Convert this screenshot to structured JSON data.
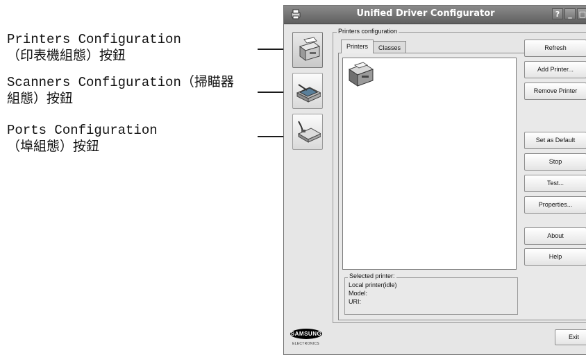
{
  "annotations": {
    "printers": {
      "line1": "Printers Configuration",
      "line2": "（印表機組態）按鈕"
    },
    "scanners": {
      "line1": "Scanners Configuration（掃瞄器",
      "line2": "組態）按鈕"
    },
    "ports": {
      "line1": "Ports Configuration",
      "line2": "（埠組態）按鈕"
    }
  },
  "window": {
    "title": "Unified Driver Configurator",
    "controls": {
      "help": "?",
      "minimize": "_",
      "maximize": "□",
      "close": "×"
    }
  },
  "sidebar": {
    "items": [
      {
        "name": "Printers Configuration",
        "icon": "printer-icon",
        "active": true
      },
      {
        "name": "Scanners Configuration",
        "icon": "scanner-icon",
        "active": false
      },
      {
        "name": "Ports Configuration",
        "icon": "port-icon",
        "active": false
      }
    ]
  },
  "main": {
    "group_label": "Printers configuration",
    "tabs": [
      {
        "label": "Printers",
        "active": true
      },
      {
        "label": "Classes",
        "active": false
      }
    ],
    "actions": {
      "refresh": "Refresh",
      "add_printer": "Add Printer...",
      "remove_printer": "Remove Printer",
      "set_default": "Set as Default",
      "stop": "Stop",
      "test": "Test...",
      "properties": "Properties...",
      "about": "About",
      "help": "Help"
    },
    "selected": {
      "label": "Selected printer:",
      "status": "Local printer(idle)",
      "model": "Model:",
      "uri": "URI:"
    }
  },
  "footer": {
    "brand": "SAMSUNG",
    "brand_sub": "ELECTRONICS",
    "exit": "Exit"
  },
  "colors": {
    "accent": "#1f7f6d",
    "titlebar": "#6e6e6e",
    "window_bg": "#e6e6e6"
  }
}
